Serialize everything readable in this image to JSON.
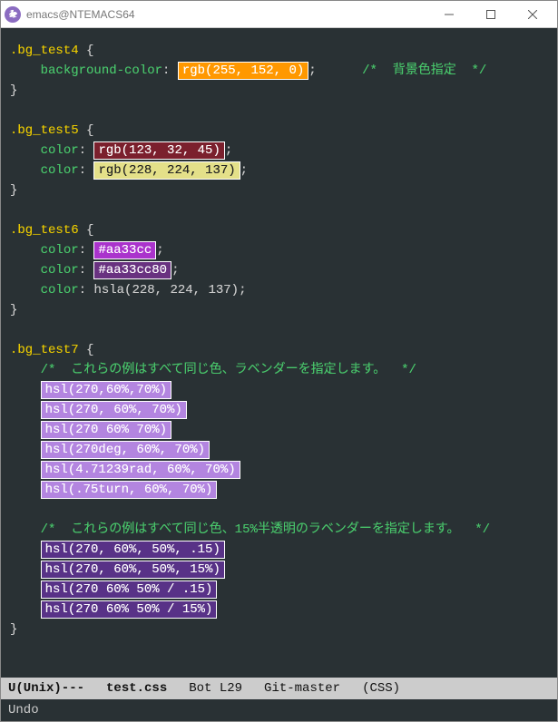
{
  "window": {
    "title": "emacs@NTEMACS64"
  },
  "code": {
    "sel4": ".bg_test4",
    "sel5": ".bg_test5",
    "sel6": ".bg_test6",
    "sel7": ".bg_test7",
    "prop_bg": "background-color",
    "prop_color": "color",
    "brace_open": "{",
    "brace_close": "}",
    "semi": ";",
    "rgb_255_152_0": "rgb(255, 152, 0)",
    "comment_bg": "/*  背景色指定  */",
    "rgb_123_32_45": "rgb(123, 32, 45)",
    "rgb_228_224_137": "rgb(228, 224, 137)",
    "hex_aa33cc": "#aa33cc",
    "hex_aa33cc80": "#aa33cc80",
    "hsla_228_224_137": "hsla(228, 224, 137);",
    "comment_lavender": "/*  これらの例はすべて同じ色、ラベンダーを指定します。  */",
    "hsl_lines": [
      "hsl(270,60%,70%)",
      "hsl(270, 60%, 70%)",
      "hsl(270 60% 70%)",
      "hsl(270deg, 60%, 70%)",
      "hsl(4.71239rad, 60%, 70%)",
      "hsl(.75turn, 60%, 70%)"
    ],
    "comment_lavender15": "/*  これらの例はすべて同じ色、15%半透明のラベンダーを指定します。  */",
    "hsl15_lines": [
      "hsl(270, 60%, 50%, .15)",
      "hsl(270, 60%, 50%, 15%)",
      "hsl(270 60% 50% / .15)",
      "hsl(270 60% 50% / 15%)"
    ]
  },
  "colors": {
    "orange": "#ff9800",
    "maroon": "#7b202d",
    "khaki": "#e4e089",
    "purple": "#aa33cc",
    "purple80": "rgba(170,51,204,0.5)",
    "lavender": "#b385e0",
    "lavender15": "rgba(153,51,204,0.6)"
  },
  "modeline": {
    "left": "U(Unix)---",
    "file": "test.css",
    "pos": "Bot L29",
    "vc": "Git-master",
    "mode": "(CSS)"
  },
  "minibuffer": "Undo"
}
